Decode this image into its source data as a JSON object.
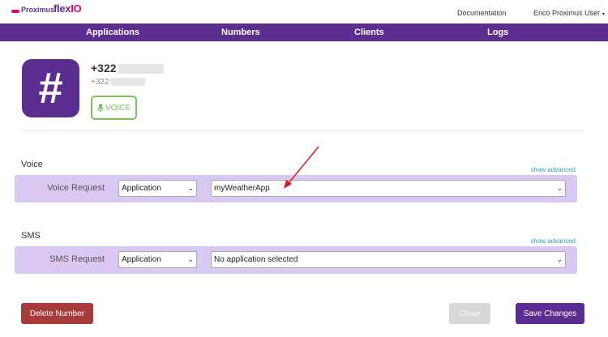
{
  "header": {
    "logo_brand": "Proximus",
    "logo_product_a": "flex",
    "logo_product_b": "IO",
    "documentation_label": "Documentation",
    "user_label": "Enco Proximus User",
    "user_caret": "▾"
  },
  "nav": {
    "items": [
      {
        "label": "Applications"
      },
      {
        "label": "Numbers"
      },
      {
        "label": "Clients"
      },
      {
        "label": "Logs"
      }
    ]
  },
  "number": {
    "icon_glyph": "#",
    "display_primary": "+322",
    "display_secondary": "+322",
    "badge_label": "VOICE"
  },
  "voice": {
    "section_title": "Voice",
    "show_advanced": "show advanced",
    "request_label": "Voice Request",
    "type_value": "Application",
    "app_value": "myWeatherApp"
  },
  "sms": {
    "section_title": "SMS",
    "show_advanced": "show advanced",
    "request_label": "SMS Request",
    "type_value": "Application",
    "app_value": "No application selected"
  },
  "actions": {
    "delete_label": "Delete Number",
    "close_label": "Close",
    "save_label": "Save Changes"
  },
  "colors": {
    "brand_purple": "#5c2d91",
    "row_lavender": "#d9c8f2",
    "voice_green": "#7cc15b",
    "delete_red": "#a83a3a",
    "link_teal": "#2ca3a7",
    "annotation_arrow": "#e0161c"
  }
}
